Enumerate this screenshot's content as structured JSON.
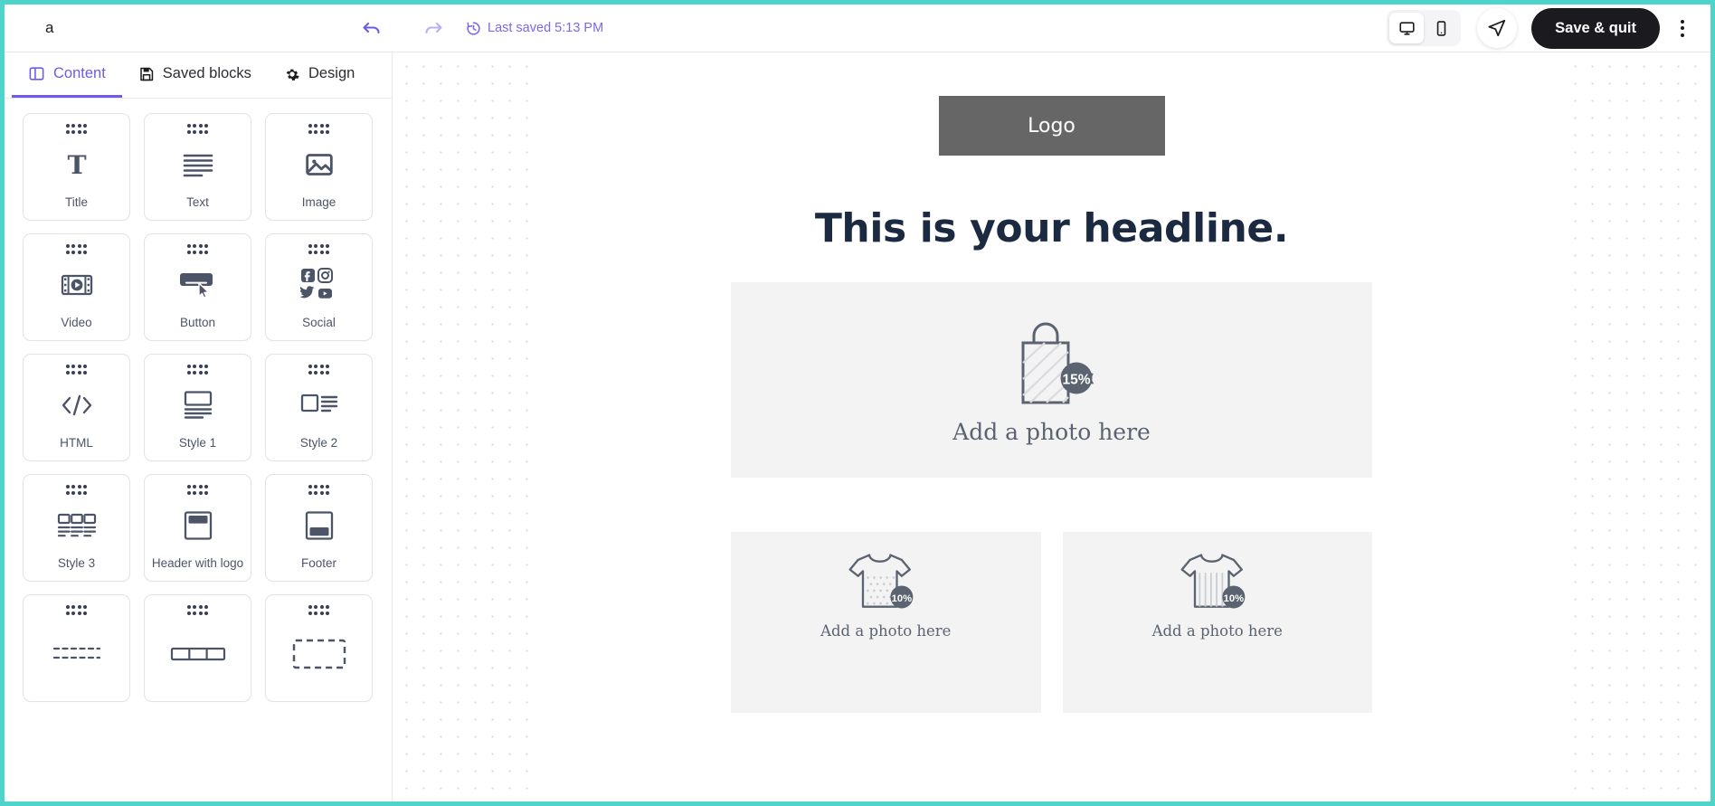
{
  "topbar": {
    "doc_title": "a",
    "undo_icon": "undo-arrow-icon",
    "redo_icon": "redo-arrow-icon",
    "saved_status": "Last saved 5:13 PM",
    "saved_icon": "history-clock-icon",
    "desktop_icon": "desktop-monitor-icon",
    "mobile_icon": "mobile-phone-icon",
    "send_icon": "send-paper-plane-icon",
    "save_quit_label": "Save & quit",
    "more_icon": "kebab-menu-icon",
    "accent_color": "#7b68ee",
    "border_color": "#4ed4cb"
  },
  "tabs": [
    {
      "label": "Content",
      "icon": "layout-panel-icon",
      "active": true
    },
    {
      "label": "Saved blocks",
      "icon": "floppy-save-icon",
      "active": false
    },
    {
      "label": "Design",
      "icon": "gear-icon",
      "active": false
    }
  ],
  "blocks": [
    {
      "label": "Title",
      "icon": "serif-t-icon"
    },
    {
      "label": "Text",
      "icon": "text-lines-icon"
    },
    {
      "label": "Image",
      "icon": "picture-icon"
    },
    {
      "label": "Video",
      "icon": "video-film-play-icon"
    },
    {
      "label": "Button",
      "icon": "button-cursor-icon"
    },
    {
      "label": "Social",
      "icon": "social-networks-icon"
    },
    {
      "label": "HTML",
      "icon": "code-brackets-icon"
    },
    {
      "label": "Style 1",
      "icon": "image-over-text-icon"
    },
    {
      "label": "Style 2",
      "icon": "image-left-text-right-icon"
    },
    {
      "label": "Style 3",
      "icon": "three-column-cards-icon"
    },
    {
      "label": "Header with logo",
      "icon": "header-logo-icon"
    },
    {
      "label": "Footer",
      "icon": "footer-icon"
    },
    {
      "label": "",
      "icon": "divider-dashed-icon"
    },
    {
      "label": "",
      "icon": "columns-three-icon"
    },
    {
      "label": "",
      "icon": "dashed-placeholder-icon"
    }
  ],
  "canvas": {
    "logo_label": "Logo",
    "logo_bg": "#666666",
    "headline": "This is your headline.",
    "hero_photo_caption": "Add a photo here",
    "hero_photo_badge": "15%",
    "hero_photo_icon": "shopping-bag-discount-icon",
    "columns": [
      {
        "caption": "Add a photo here",
        "badge": "10%",
        "icon": "tshirt-dotted-discount-icon"
      },
      {
        "caption": "Add a photo here",
        "badge": "10%",
        "icon": "tshirt-striped-discount-icon"
      }
    ]
  }
}
